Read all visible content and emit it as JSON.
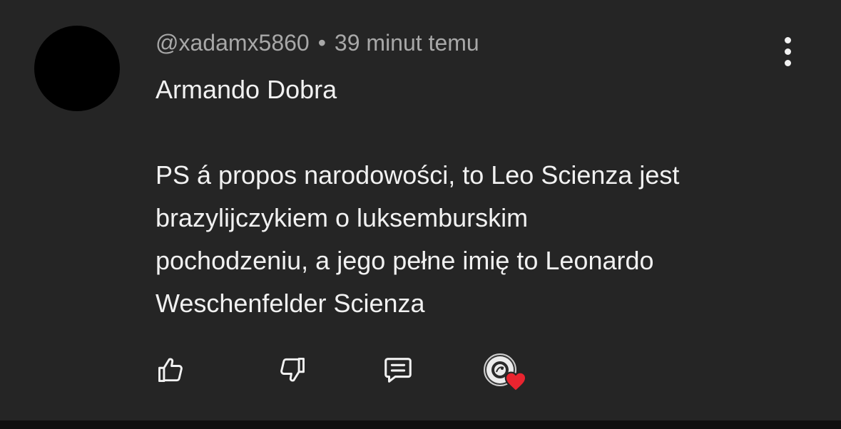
{
  "comment": {
    "author": "@xadamx5860",
    "separator": "•",
    "timestamp": "39 minut temu",
    "lines": [
      "Armando Dobra",
      "PS á propos narodowości, to Leo Scienza jest",
      "brazylijczykiem o luksemburskim",
      "pochodzeniu, a jego pełne imię to Leonardo",
      "Weschenfelder Scienza"
    ]
  },
  "actions": {
    "like_icon": "thumbs-up-icon",
    "dislike_icon": "thumbs-down-icon",
    "reply_icon": "reply-comment-icon",
    "creator_heart_icon": "creator-heart-icon"
  },
  "colors": {
    "background": "#252525",
    "text_primary": "#f1f1f1",
    "text_secondary": "#a8a8a8",
    "heart": "#e8242f"
  }
}
